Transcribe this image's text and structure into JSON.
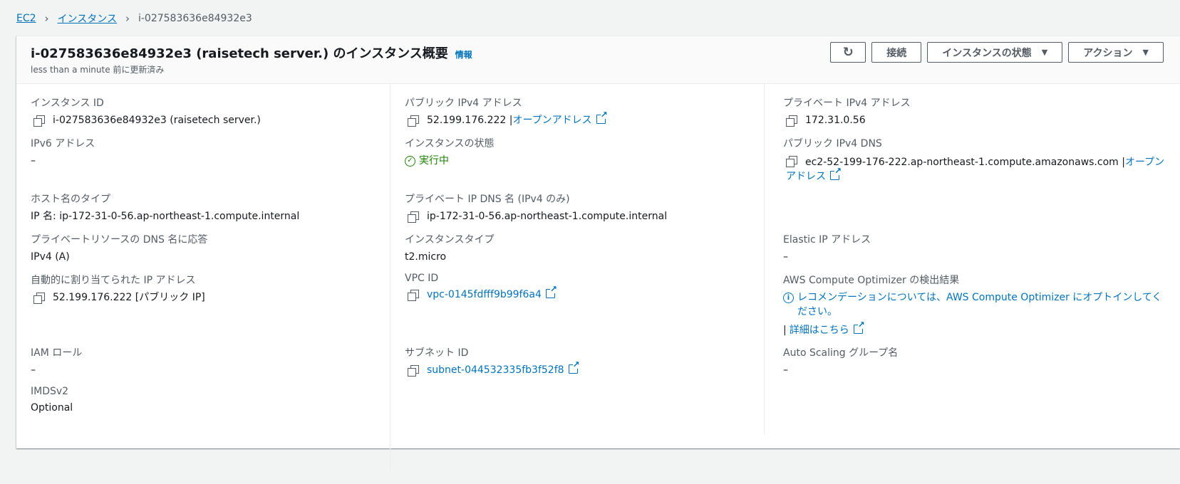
{
  "breadcrumb": {
    "root": "EC2",
    "parent": "インスタンス",
    "current": "i-027583636e84932e3"
  },
  "header": {
    "title": "i-027583636e84932e3 (raisetech server.) のインスタンス概要",
    "info": "情報",
    "updated": "less than a minute 前に更新済み",
    "connect": "接続",
    "state": "インスタンスの状態",
    "actions": "アクション"
  },
  "col1": {
    "instance_id_label": "インスタンス ID",
    "instance_id": "i-027583636e84932e3 (raisetech server.)",
    "ipv6_label": "IPv6 アドレス",
    "ipv6": "–",
    "hostname_type_label": "ホスト名のタイプ",
    "hostname_type": "IP 名: ip-172-31-0-56.ap-northeast-1.compute.internal",
    "private_dns_answer_label": "プライベートリソースの DNS 名に応答",
    "private_dns_answer": "IPv4 (A)",
    "auto_ip_label": "自動的に割り当てられた IP アドレス",
    "auto_ip": "52.199.176.222 [パブリック IP]",
    "iam_label": "IAM ロール",
    "iam": "–",
    "imds_label": "IMDSv2",
    "imds": "Optional"
  },
  "col2": {
    "public_ipv4_label": "パブリック IPv4 アドレス",
    "public_ipv4": "52.199.176.222 |",
    "open_address": "オープンアドレス",
    "state_label": "インスタンスの状態",
    "state": "実行中",
    "private_dns_label": "プライベート IP DNS 名 (IPv4 のみ)",
    "private_dns": "ip-172-31-0-56.ap-northeast-1.compute.internal",
    "type_label": "インスタンスタイプ",
    "type": "t2.micro",
    "vpc_label": "VPC ID",
    "vpc": "vpc-0145fdfff9b99f6a4",
    "subnet_label": "サブネット ID",
    "subnet": "subnet-044532335fb3f52f8"
  },
  "col3": {
    "private_ipv4_label": "プライベート IPv4 アドレス",
    "private_ipv4": "172.31.0.56",
    "public_dns_label": "パブリック IPv4 DNS",
    "public_dns": "ec2-52-199-176-222.ap-northeast-1.compute.amazonaws.com |",
    "open_address": "オープンアドレス",
    "elastic_label": "Elastic IP アドレス",
    "elastic": "–",
    "optimizer_label": "AWS Compute Optimizer の検出結果",
    "optimizer_text": "レコメンデーションについては、AWS Compute Optimizer にオプトインしてください。",
    "details_prefix": "|",
    "details": "詳細はこちら",
    "asg_label": "Auto Scaling グループ名",
    "asg": "–"
  }
}
